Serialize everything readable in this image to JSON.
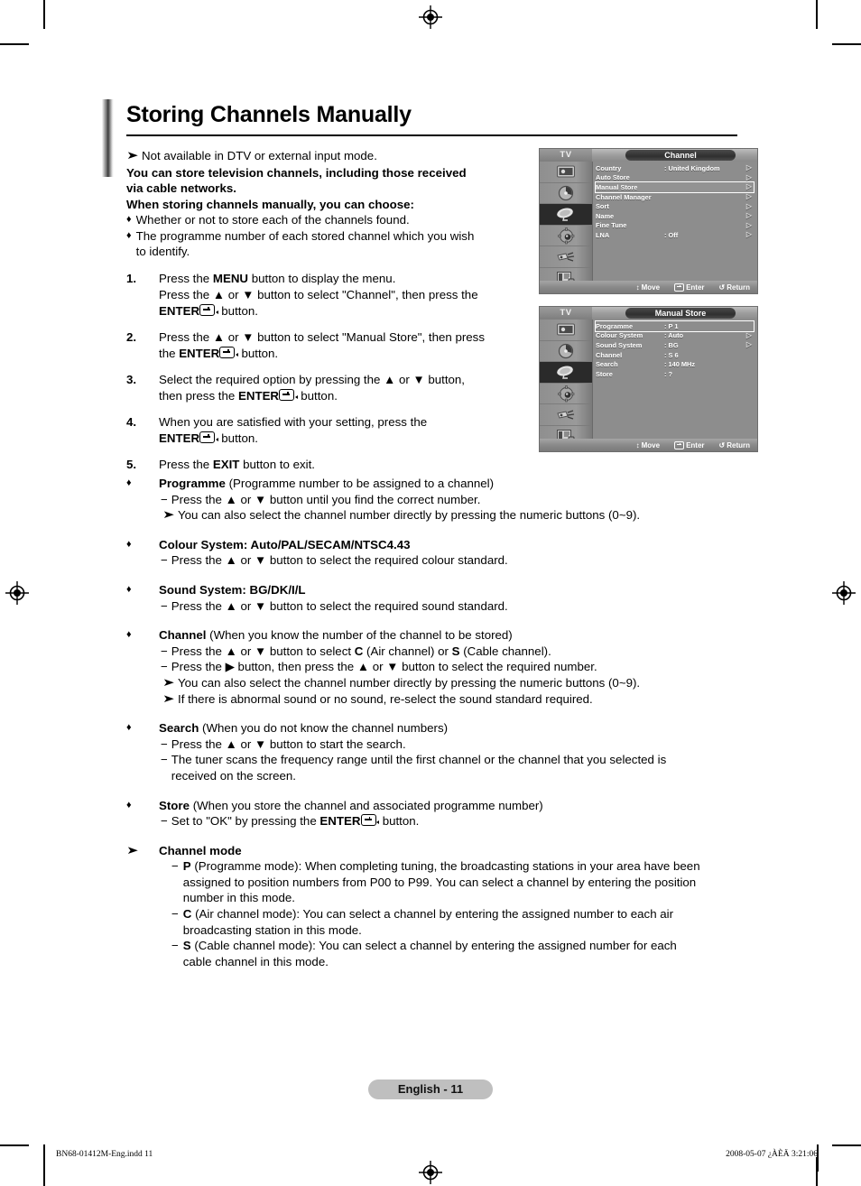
{
  "document": {
    "title": "Storing Channels Manually",
    "page_badge": "English - 11",
    "print_footer_left": "BN68-01412M-Eng.indd   11",
    "print_footer_right": "2008-05-07   ¿ÀÈÄ 3:21:06"
  },
  "intro": {
    "note": "Not available in DTV or external input mode.",
    "bold_1": "You can store television channels, including those received",
    "bold_2": "via cable networks.",
    "bold_3": "When storing channels manually, you can choose:",
    "bullet_1": "Whether or not to store each of the channels found.",
    "bullet_2a": "The programme number of each stored channel which you wish",
    "bullet_2b": "to identify."
  },
  "steps": [
    {
      "num": "1.",
      "line1_a": "Press the ",
      "line1_b": "MENU",
      "line1_c": " button to display the menu.",
      "line2": "Press the ▲ or ▼ button to select \"Channel\", then press the",
      "line3_a": "ENTER",
      "line3_b": " button."
    },
    {
      "num": "2.",
      "line1": "Press the ▲ or ▼ button to select \"Manual Store\", then press",
      "line2_a": "the ",
      "line2_b": "ENTER",
      "line2_c": " button."
    },
    {
      "num": "3.",
      "line1": "Select the required option by pressing the ▲ or ▼ button,",
      "line2_a": "then press the ",
      "line2_b": "ENTER",
      "line2_c": " button."
    },
    {
      "num": "4.",
      "line1": "When you are satisfied with your setting, press the",
      "line2_a": "ENTER",
      "line2_b": " button."
    },
    {
      "num": "5.",
      "line1_a": "Press the ",
      "line1_b": "EXIT",
      "line1_c": " button to exit."
    }
  ],
  "options": {
    "programme": {
      "bullet": "♦",
      "title": "Programme",
      "title_rest": " (Programme number to be assigned to a channel)",
      "dash1": "Press the ▲ or ▼ button until you find the correct number.",
      "note1": "You can also select the channel number directly by pressing the numeric buttons (0~9)."
    },
    "colour_system": {
      "bullet": "♦",
      "title": "Colour System: Auto/PAL/SECAM/NTSC4.43",
      "dash1": "Press the ▲ or ▼ button to select the required colour standard."
    },
    "sound_system": {
      "bullet": "♦",
      "title": "Sound System: BG/DK/I/L",
      "dash1": "Press the ▲ or ▼ button to select the required sound standard."
    },
    "channel": {
      "bullet": "♦",
      "title": "Channel",
      "title_rest": " (When you know the number of the channel to be stored)",
      "dash1_a": "Press the ▲ or ▼ button to select ",
      "dash1_b": "C",
      "dash1_c": " (Air channel) or ",
      "dash1_d": "S",
      "dash1_e": " (Cable channel).",
      "dash2": "Press the ▶ button, then press the ▲ or ▼ button to select the required number.",
      "note1": "You can also select the channel number directly by pressing the numeric buttons (0~9).",
      "note2": "If there is abnormal sound or no sound, re-select the sound standard required."
    },
    "search": {
      "bullet": "♦",
      "title": "Search",
      "title_rest": " (When you do not know the channel numbers)",
      "dash1": "Press the ▲ or ▼ button to start the search.",
      "dash2_a": "The tuner scans the frequency range until the first channel or the channel that you selected is",
      "dash2_b": "received on the screen."
    },
    "store": {
      "bullet": "♦",
      "title": "Store",
      "title_rest": " (When you store the channel and associated programme number)",
      "dash1_a": "Set to \"OK\" by pressing the ",
      "dash1_b": "ENTER",
      "dash1_c": " button."
    },
    "channel_mode": {
      "bullet": "➤",
      "title": "Channel mode",
      "p": {
        "key": "P",
        "l1": " (Programme mode): When completing tuning, the broadcasting stations in your area have been",
        "l2": "assigned to position numbers from P00 to P99. You can select a channel by entering the position",
        "l3": "number in this mode."
      },
      "c": {
        "key": "C",
        "l1": " (Air channel mode): You can select a channel by entering the assigned number to each air",
        "l2": "broadcasting station in this mode."
      },
      "s": {
        "key": "S",
        "l1": " (Cable channel mode): You can select a channel by entering the assigned number for each",
        "l2": "cable channel in this mode."
      }
    }
  },
  "osd": {
    "sidebar_icons": [
      "picture-icon",
      "sound-icon",
      "channel-dish-icon",
      "setup-gear-icon",
      "input-plug-icon",
      "pc-list-icon"
    ],
    "footer": {
      "move": "Move",
      "enter": "Enter",
      "return": "Return",
      "move_icon": "↕",
      "return_icon": "↺"
    },
    "menu1": {
      "tv_label": "TV",
      "title": "Channel",
      "selected_index": 2,
      "rows": [
        {
          "label": "Country",
          "value": ": United Kingdom",
          "arrow": "▷"
        },
        {
          "label": "Auto Store",
          "value": "",
          "arrow": "▷"
        },
        {
          "label": "Manual Store",
          "value": "",
          "arrow": "▷"
        },
        {
          "label": "Channel Manager",
          "value": "",
          "arrow": "▷"
        },
        {
          "label": "Sort",
          "value": "",
          "arrow": "▷"
        },
        {
          "label": "Name",
          "value": "",
          "arrow": "▷"
        },
        {
          "label": "Fine Tune",
          "value": "",
          "arrow": "▷"
        },
        {
          "label": "LNA",
          "value": ": Off",
          "arrow": "▷"
        }
      ]
    },
    "menu2": {
      "tv_label": "TV",
      "title": "Manual Store",
      "selected_index": 0,
      "rows": [
        {
          "label": "Programme",
          "value": ": P 1",
          "arrow": ""
        },
        {
          "label": "Colour System",
          "value": ": Auto",
          "arrow": "▷"
        },
        {
          "label": "Sound System",
          "value": ": BG",
          "arrow": "▷"
        },
        {
          "label": "Channel",
          "value": ": S 6",
          "arrow": ""
        },
        {
          "label": "Search",
          "value": ": 140 MHz",
          "arrow": ""
        },
        {
          "label": "Store",
          "value": ": ?",
          "arrow": ""
        }
      ]
    }
  }
}
